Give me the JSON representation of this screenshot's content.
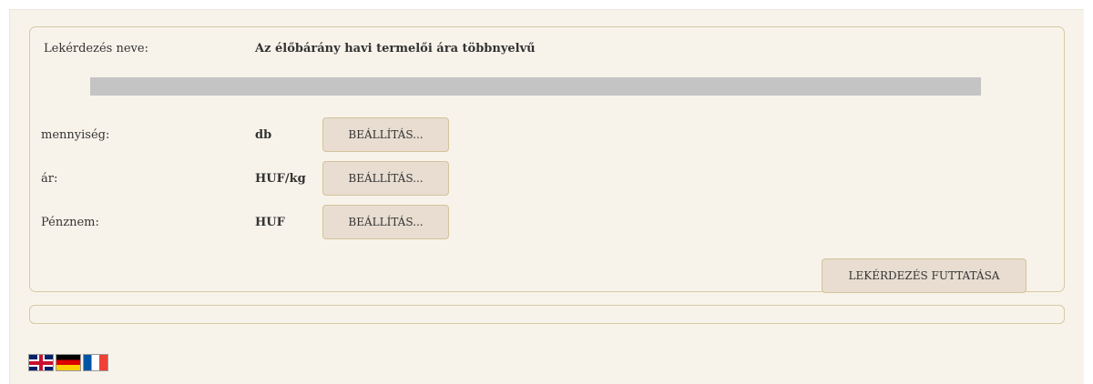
{
  "query": {
    "name_label": "Lekérdezés neve:",
    "name_value": "Az élőbárány havi termelői ára többnyelvű",
    "progress": 1.0
  },
  "settings": [
    {
      "label": "mennyiség:",
      "value": "db",
      "button": "BEÁLLÍTÁS..."
    },
    {
      "label": "ár:",
      "value": "HUF/kg",
      "button": "BEÁLLÍTÁS..."
    },
    {
      "label": "Pénznem:",
      "value": "HUF",
      "button": "BEÁLLÍTÁS..."
    }
  ],
  "run_button": "LEKÉRDEZÉS FUTTATÁSA",
  "languages": [
    "english-flag-icon",
    "german-flag-icon",
    "french-flag-icon"
  ]
}
